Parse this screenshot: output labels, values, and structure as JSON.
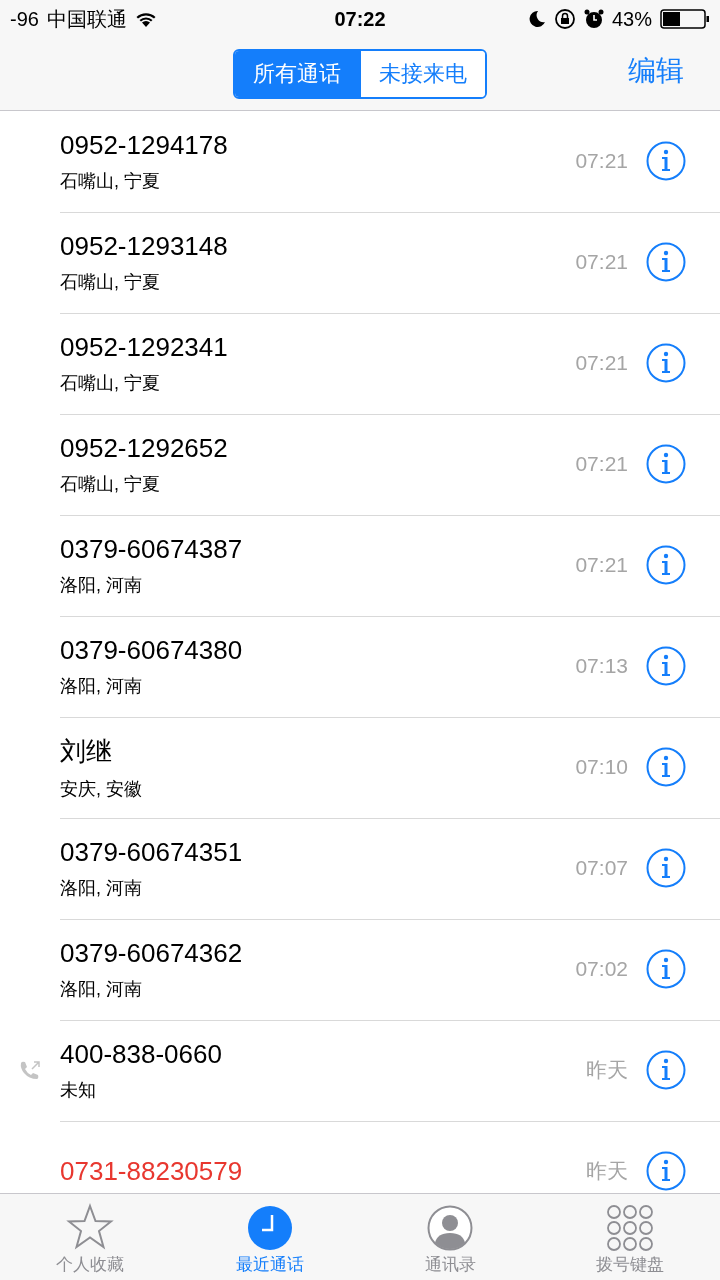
{
  "status_bar": {
    "signal": "-96",
    "carrier": "中国联通",
    "time": "07:22",
    "battery_text": "43%"
  },
  "nav": {
    "segments": [
      {
        "label": "所有通话",
        "selected": true
      },
      {
        "label": "未接来电",
        "selected": false
      }
    ],
    "edit": "编辑"
  },
  "calls": [
    {
      "name": "0952-1294178",
      "location": "石嘴山, 宁夏",
      "time": "07:21",
      "missed": false,
      "outgoing": false
    },
    {
      "name": "0952-1293148",
      "location": "石嘴山, 宁夏",
      "time": "07:21",
      "missed": false,
      "outgoing": false
    },
    {
      "name": "0952-1292341",
      "location": "石嘴山, 宁夏",
      "time": "07:21",
      "missed": false,
      "outgoing": false
    },
    {
      "name": "0952-1292652",
      "location": "石嘴山, 宁夏",
      "time": "07:21",
      "missed": false,
      "outgoing": false
    },
    {
      "name": "0379-60674387",
      "location": "洛阳, 河南",
      "time": "07:21",
      "missed": false,
      "outgoing": false
    },
    {
      "name": "0379-60674380",
      "location": "洛阳, 河南",
      "time": "07:13",
      "missed": false,
      "outgoing": false
    },
    {
      "name": "刘继",
      "location": "安庆, 安徽",
      "time": "07:10",
      "missed": false,
      "outgoing": false
    },
    {
      "name": "0379-60674351",
      "location": "洛阳, 河南",
      "time": "07:07",
      "missed": false,
      "outgoing": false
    },
    {
      "name": "0379-60674362",
      "location": "洛阳, 河南",
      "time": "07:02",
      "missed": false,
      "outgoing": false
    },
    {
      "name": "400-838-0660",
      "location": "未知",
      "time": "昨天",
      "missed": false,
      "outgoing": true
    },
    {
      "name": "0731-88230579",
      "time": "昨天",
      "missed": true,
      "outgoing": false
    }
  ],
  "tabs": [
    {
      "label": "个人收藏",
      "kind": "favorites",
      "selected": false
    },
    {
      "label": "最近通话",
      "kind": "recents",
      "selected": true
    },
    {
      "label": "通讯录",
      "kind": "contacts",
      "selected": false
    },
    {
      "label": "拨号键盘",
      "kind": "keypad",
      "selected": false
    }
  ]
}
